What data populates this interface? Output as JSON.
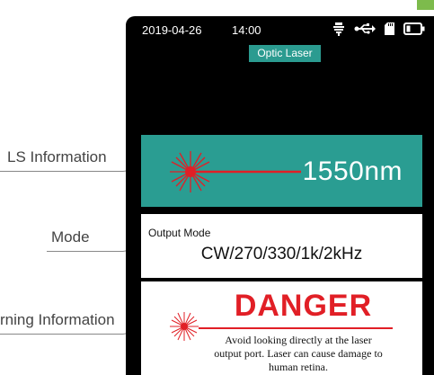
{
  "status_bar": {
    "date": "2019-04-26",
    "time": "14:00",
    "icons": [
      "bulb-icon",
      "usb-icon",
      "sd-card-icon",
      "battery-icon"
    ]
  },
  "screen_title": "Optic Laser",
  "ls_information": {
    "wavelength": "1550nm",
    "icon": "laser-beam-icon"
  },
  "mode": {
    "label": "Output Mode",
    "value": "CW/270/330/1k/2kHz"
  },
  "warning": {
    "title": "DANGER",
    "text": "Avoid looking directly at the laser output port. Laser can cause damage to human retina.",
    "icon": "laser-burst-icon"
  },
  "callouts": {
    "ls": "LS Information",
    "mode": "Mode",
    "warning": "rning Information"
  },
  "colors": {
    "teal": "#2a9d92",
    "danger_red": "#e11f26",
    "laser_red": "#e11f26",
    "accent_green": "#7dbb4c"
  }
}
